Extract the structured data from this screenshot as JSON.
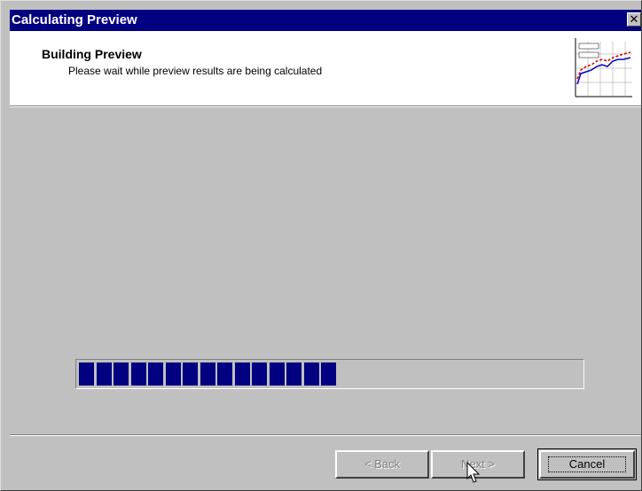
{
  "window": {
    "title": "Calculating Preview",
    "close_glyph": "✕"
  },
  "header": {
    "title": "Building Preview",
    "subtitle": "Please wait while preview results are being calculated",
    "graphic_icon": "chart-preview-icon"
  },
  "progress": {
    "filled_blocks": 15,
    "total_blocks": 30,
    "fraction": 0.5,
    "color": "#000080"
  },
  "buttons": {
    "back_label": "< Back",
    "next_label": "Next >",
    "cancel_label": "Cancel"
  },
  "colors": {
    "titlebar": "#000080",
    "face": "#c0c0c0",
    "header_bg": "#ffffff"
  }
}
